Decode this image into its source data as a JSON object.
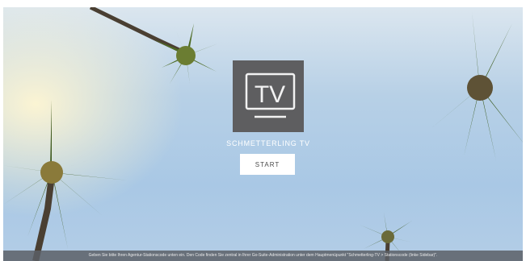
{
  "app": {
    "logo_icon": "tv-icon",
    "logo_text": "TV",
    "brand_name": "SCHMETTERLING TV",
    "start_label": "START"
  },
  "footer": {
    "hint": "Geben Sie bitte Ihren Agentur-Stationscode unten ein. Den Code finden Sie zentral in Ihrer Go-Suite-Administration unter dem Hauptmenüpunkt \"Schmetterling-TV > Stationscode (linke Sidebar)\"."
  },
  "colors": {
    "tile": "#5e5e60",
    "button_bg": "#ffffff",
    "footer_bg": "#5a5f66",
    "sky": "#a9c8e5"
  }
}
